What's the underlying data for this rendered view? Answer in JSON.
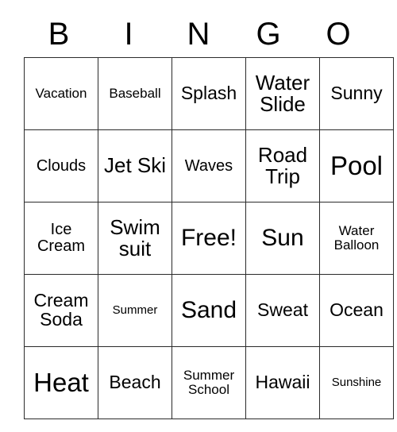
{
  "card": {
    "title": "BINGO",
    "header_letters": [
      "B",
      "I",
      "N",
      "G",
      "O"
    ],
    "free_space_label": "Free!",
    "colors": {
      "background": "#ffffff",
      "text": "#000000",
      "border": "#2b2b2b"
    },
    "rows": [
      [
        {
          "label": "Vacation",
          "size": "sm"
        },
        {
          "label": "Baseball",
          "size": "sm"
        },
        {
          "label": "Splash",
          "size": "lg"
        },
        {
          "label": "Water Slide",
          "size": "xl"
        },
        {
          "label": "Sunny",
          "size": "lg"
        }
      ],
      [
        {
          "label": "Clouds",
          "size": "md"
        },
        {
          "label": "Jet Ski",
          "size": "xl"
        },
        {
          "label": "Waves",
          "size": "md"
        },
        {
          "label": "Road Trip",
          "size": "xl"
        },
        {
          "label": "Pool",
          "size": "huge"
        }
      ],
      [
        {
          "label": "Ice Cream",
          "size": "md"
        },
        {
          "label": "Swim suit",
          "size": "xl"
        },
        {
          "label": "Free!",
          "size": "xxl"
        },
        {
          "label": "Sun",
          "size": "xxl"
        },
        {
          "label": "Water Balloon",
          "size": "sm"
        }
      ],
      [
        {
          "label": "Cream Soda",
          "size": "lg"
        },
        {
          "label": "Summer",
          "size": "xs"
        },
        {
          "label": "Sand",
          "size": "xxl"
        },
        {
          "label": "Sweat",
          "size": "lg"
        },
        {
          "label": "Ocean",
          "size": "lg"
        }
      ],
      [
        {
          "label": "Heat",
          "size": "huge"
        },
        {
          "label": "Beach",
          "size": "lg"
        },
        {
          "label": "Summer School",
          "size": "sm"
        },
        {
          "label": "Hawaii",
          "size": "lg"
        },
        {
          "label": "Sunshine",
          "size": "xs"
        }
      ]
    ]
  }
}
